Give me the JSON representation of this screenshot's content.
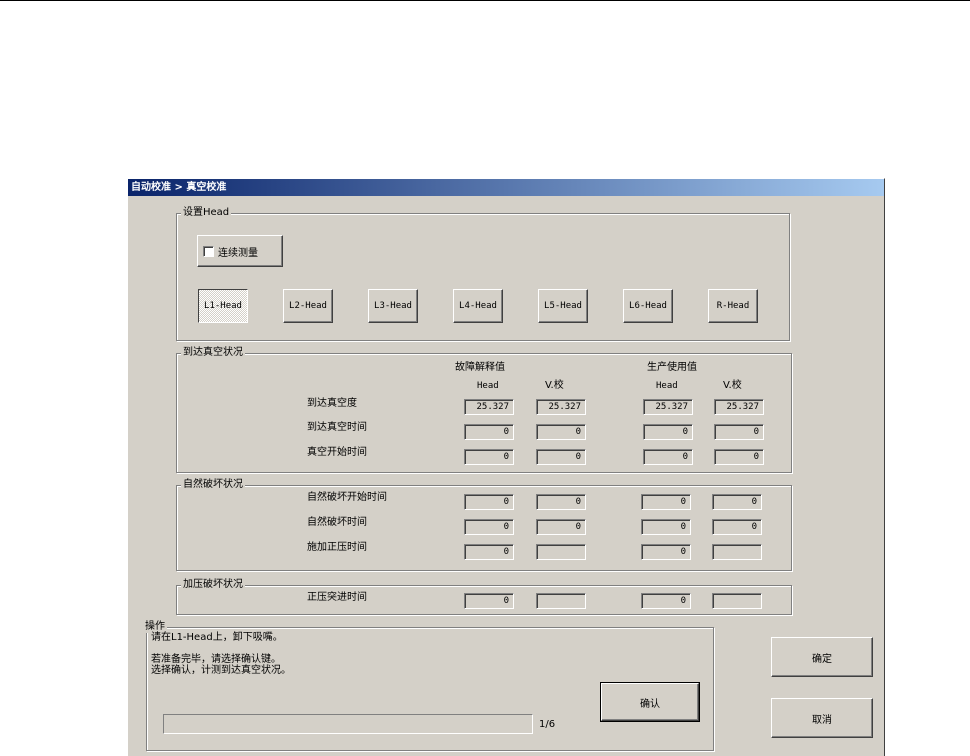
{
  "window": {
    "title": "自动校准 > 真空校准"
  },
  "head_group": {
    "label": "设置Head",
    "continuous_measure": {
      "label": "连续测量",
      "checked": false
    },
    "heads": [
      "L1-Head",
      "L2-Head",
      "L3-Head",
      "L4-Head",
      "L5-Head",
      "L6-Head",
      "R-Head"
    ],
    "selected_head": "L1-Head"
  },
  "col_headers": {
    "fault_group": "故障解释值",
    "prod_group": "生产使用值",
    "head": "Head",
    "vcal": "V.校"
  },
  "vacuum_group": {
    "label": "到达真空状况",
    "rows": [
      {
        "label": "到达真空度",
        "values": [
          "25.327",
          "25.327",
          "25.327",
          "25.327"
        ]
      },
      {
        "label": "到达真空时间",
        "values": [
          "0",
          "0",
          "0",
          "0"
        ]
      },
      {
        "label": "真空开始时间",
        "values": [
          "0",
          "0",
          "0",
          "0"
        ]
      }
    ]
  },
  "natural_group": {
    "label": "自然破坏状况",
    "rows": [
      {
        "label": "自然破坏开始时间",
        "values": [
          "0",
          "0",
          "0",
          "0"
        ]
      },
      {
        "label": "自然破坏时间",
        "values": [
          "0",
          "0",
          "0",
          "0"
        ]
      },
      {
        "label": "施加正压时间",
        "values": [
          "0",
          "",
          "0",
          ""
        ]
      }
    ]
  },
  "pressure_group": {
    "label": "加压破坏状况",
    "rows": [
      {
        "label": "正压突进时间",
        "values": [
          "0",
          "",
          "0",
          ""
        ]
      }
    ]
  },
  "operation": {
    "label": "操作",
    "line1": "请在L1-Head上，卸下吸嘴。",
    "line2": "若准备完毕，请选择确认键。",
    "line3": "选择确认，计测到达真空状况。",
    "confirm_label": "确认",
    "progress_text": "1/6",
    "progress_fraction": 0
  },
  "buttons": {
    "ok_label": "确定",
    "cancel_label": "取消"
  },
  "colors": {
    "dialog_bg": "#d4d0c8",
    "title_start": "#0a246a",
    "title_end": "#a6caf0"
  }
}
